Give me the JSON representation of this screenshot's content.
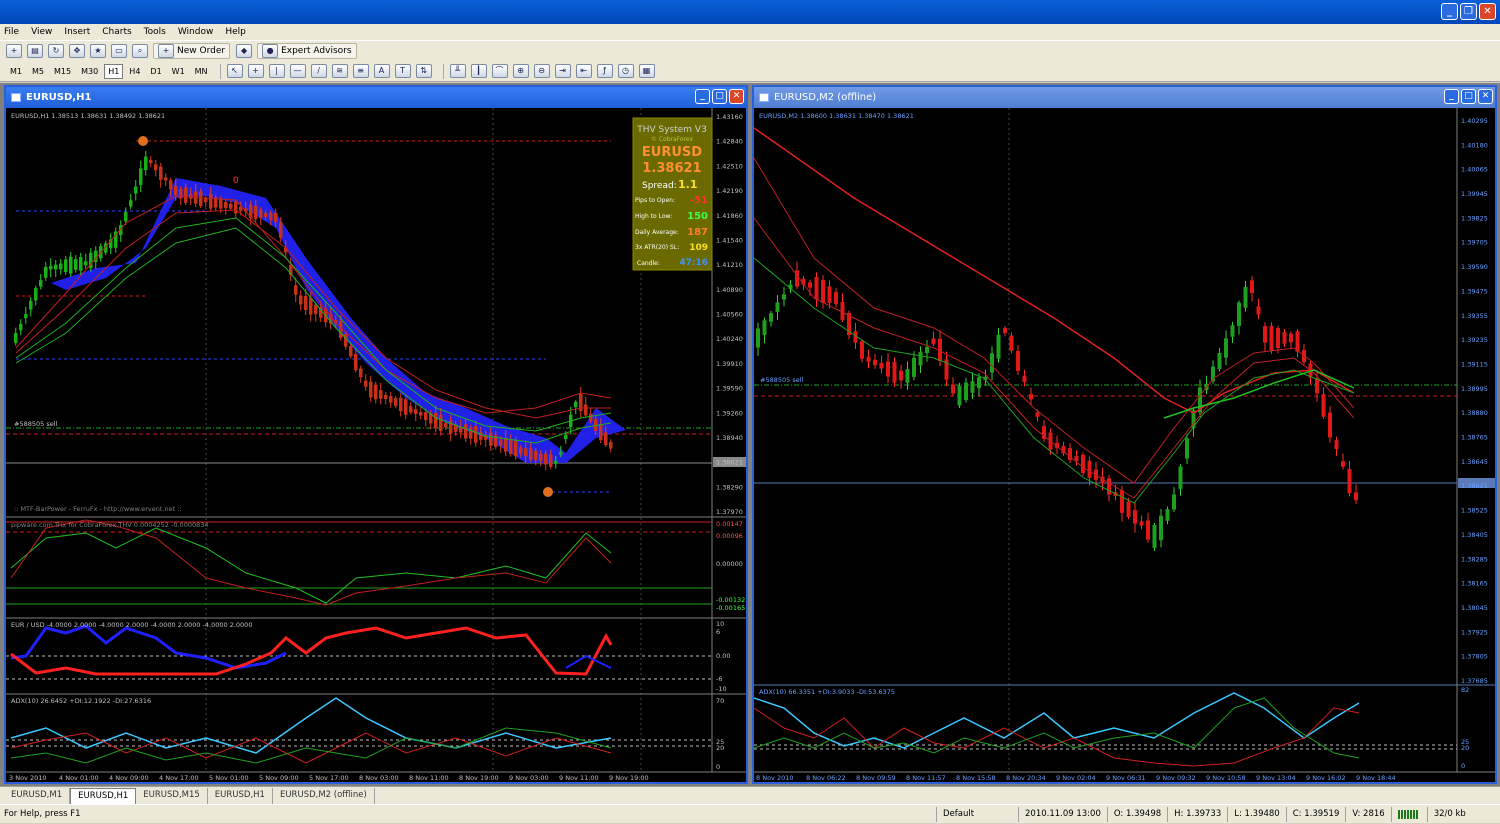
{
  "menu": [
    "File",
    "View",
    "Insert",
    "Charts",
    "Tools",
    "Window",
    "Help"
  ],
  "toolbar": {
    "new_order": "New Order",
    "expert_advisors": "Expert Advisors"
  },
  "timeframes": [
    "M1",
    "M5",
    "M15",
    "M30",
    "H1",
    "H4",
    "D1",
    "W1",
    "MN"
  ],
  "active_timeframe": "H1",
  "left_window": {
    "title": "EURUSD,H1",
    "price_header": "EURUSD,H1  1.38513 1.38631 1.38492 1.38621",
    "price_axis": [
      "1.43160",
      "1.42840",
      "1.42510",
      "1.42190",
      "1.41860",
      "1.41540",
      "1.41210",
      "1.40890",
      "1.40560",
      "1.40240",
      "1.39910",
      "1.39590",
      "1.39260",
      "1.38940",
      "1.38621",
      "1.38290",
      "1.37970"
    ],
    "current_price": "1.38621",
    "sell_label": "#588505 sell",
    "watermark": ":: MTF-BarPower - FerruFx - http://www.ervent.net ::",
    "info_panel": {
      "system": "THV System V3",
      "brand": "© CobraForex",
      "symbol": "EURUSD",
      "price": "1.38621",
      "spread_label": "Spread:",
      "spread": "1.1",
      "rows": [
        {
          "label": "Pips to Open:",
          "value": "-51"
        },
        {
          "label": "High to Low:",
          "value": "150"
        },
        {
          "label": "Daily Average:",
          "value": "187"
        },
        {
          "label": "3x ATR(20) SL:",
          "value": "109"
        },
        {
          "label": "Candle:",
          "value": "47:16"
        }
      ]
    },
    "trix_header": "pipware.com Trix for CobraForex THV 0.0004252 -0.0000834",
    "trix_axis": [
      "0.00147",
      "0.00096",
      "0.00000",
      "-0.00132",
      "-0.00165"
    ],
    "eurusd_header": "EUR / USD -4.0000 2.0000 -4.0000 2.0000 -4.0000 2.0000 -4.0000 2.0000",
    "eurusd_axis": [
      "10",
      "6",
      "0.00",
      "-6",
      "-10"
    ],
    "adx_header": "ADX(10) 26.6452 +DI:12.1922 -DI:27.6316",
    "adx_axis": [
      "70",
      "25",
      "20",
      "0"
    ],
    "time_axis": [
      "3 Nov 2010",
      "4 Nov 01:00",
      "4 Nov 09:00",
      "4 Nov 17:00",
      "5 Nov 01:00",
      "5 Nov 09:00",
      "5 Nov 17:00",
      "8 Nov 03:00",
      "8 Nov 11:00",
      "8 Nov 19:00",
      "9 Nov 03:00",
      "9 Nov 11:00",
      "9 Nov 19:00"
    ]
  },
  "right_window": {
    "title": "EURUSD,M2 (offline)",
    "price_header": "EURUSD,M2  1.38600 1.38631 1.38470 1.38621",
    "price_axis": [
      "1.40295",
      "1.40180",
      "1.40065",
      "1.39945",
      "1.39825",
      "1.39705",
      "1.39590",
      "1.39475",
      "1.39355",
      "1.39235",
      "1.39115",
      "1.38995",
      "1.38880",
      "1.38765",
      "1.38645",
      "1.38621",
      "1.38525",
      "1.38405",
      "1.38285",
      "1.38165",
      "1.38045",
      "1.37925",
      "1.37805",
      "1.37685"
    ],
    "sell_label": "#588505 sell",
    "adx_header": "ADX(10) 66.3351 +DI:3.9033 -DI:53.6375",
    "adx_axis": [
      "82",
      "25",
      "20",
      "0"
    ],
    "time_axis": [
      "8 Nov 2010",
      "8 Nov 06:22",
      "8 Nov 09:59",
      "8 Nov 11:57",
      "8 Nov 15:58",
      "8 Nov 20:34",
      "9 Nov 02:04",
      "9 Nov 06:31",
      "9 Nov 09:32",
      "9 Nov 10:58",
      "9 Nov 13:04",
      "9 Nov 16:02",
      "9 Nov 18:44"
    ]
  },
  "tabs": [
    "EURUSD,M1",
    "EURUSD,H1",
    "EURUSD,M15",
    "EURUSD,H1",
    "EURUSD,M2 (offline)"
  ],
  "active_tab": 1,
  "status": {
    "help": "For Help, press F1",
    "profile": "Default",
    "datetime": "2010.11.09 13:00",
    "open": "O: 1.39498",
    "high": "H: 1.39733",
    "low": "L: 1.39480",
    "close": "C: 1.39519",
    "volume": "V: 2816",
    "traffic": "32/0 kb"
  }
}
